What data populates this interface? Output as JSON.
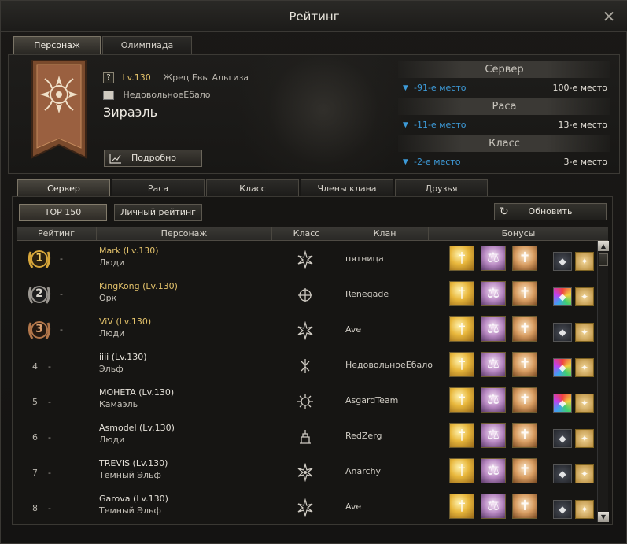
{
  "window": {
    "title": "Рейтинг"
  },
  "top_tabs": [
    {
      "label": "Персонаж",
      "active": true
    },
    {
      "label": "Олимпиада",
      "active": false
    }
  ],
  "player": {
    "level": "Lv.130",
    "class_name": "Жрец Евы Альгиза",
    "clan": "НедовольноеЕбало",
    "name": "Зираэль",
    "details_button": "Подробно"
  },
  "ranks": [
    {
      "header": "Сервер",
      "delta": "-91-е место",
      "place": "100-е место"
    },
    {
      "header": "Раса",
      "delta": "-11-е место",
      "place": "13-е место"
    },
    {
      "header": "Класс",
      "delta": "-2-е место",
      "place": "3-е место"
    }
  ],
  "sub_tabs": [
    {
      "label": "Сервер",
      "active": true
    },
    {
      "label": "Раса",
      "active": false
    },
    {
      "label": "Класс",
      "active": false
    },
    {
      "label": "Члены клана",
      "active": false
    },
    {
      "label": "Друзья",
      "active": false
    }
  ],
  "toolbar": {
    "top150": "TOP 150",
    "personal": "Личный рейтинг",
    "refresh": "Обновить"
  },
  "columns": [
    "Рейтинг",
    "Персонаж",
    "Класс",
    "Клан",
    "Бонусы"
  ],
  "rows": [
    {
      "rank": "1",
      "change": "-",
      "name": "Mark (Lv.130)",
      "race": "Люди",
      "clan": "пятница",
      "medal": "gold"
    },
    {
      "rank": "2",
      "change": "-",
      "name": "KingKong (Lv.130)",
      "race": "Орк",
      "clan": "Renegade",
      "medal": "silver"
    },
    {
      "rank": "3",
      "change": "-",
      "name": "ViV (Lv.130)",
      "race": "Люди",
      "clan": "Ave",
      "medal": "bronze"
    },
    {
      "rank": "4",
      "change": "-",
      "name": "iiii (Lv.130)",
      "race": "Эльф",
      "clan": "НедовольноеЕбало",
      "medal": ""
    },
    {
      "rank": "5",
      "change": "-",
      "name": "MOHETA (Lv.130)",
      "race": "Камаэль",
      "clan": "AsgardTeam",
      "medal": ""
    },
    {
      "rank": "6",
      "change": "-",
      "name": "Asmodel (Lv.130)",
      "race": "Люди",
      "clan": "RedZerg",
      "medal": ""
    },
    {
      "rank": "7",
      "change": "-",
      "name": "TREVIS (Lv.130)",
      "race": "Темный Эльф",
      "clan": "Anarchy",
      "medal": ""
    },
    {
      "rank": "8",
      "change": "-",
      "name": "Garova (Lv.130)",
      "race": "Темный Эльф",
      "clan": "Ave",
      "medal": ""
    }
  ],
  "icons": {
    "close": "close-icon",
    "refresh": "refresh-icon",
    "details": "chart-icon",
    "help": "question-icon"
  },
  "colors": {
    "gold_text": "#e3c26b",
    "delta_blue": "#3d9bd9",
    "gold_medal": "#d7a63a",
    "silver_medal": "#9a9690",
    "bronze_medal": "#b2764a"
  }
}
